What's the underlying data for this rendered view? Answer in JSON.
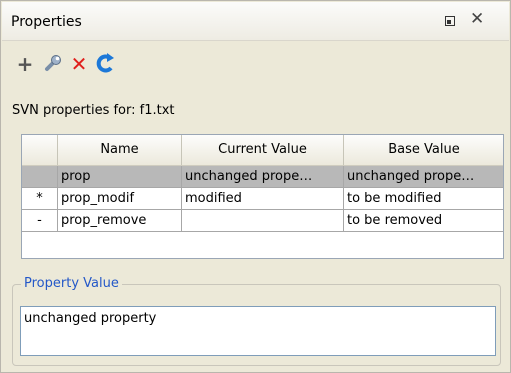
{
  "window": {
    "title": "Properties",
    "minimize_icon": "minimize-icon",
    "close_icon": "close-icon"
  },
  "toolbar": {
    "items": [
      {
        "icon": "add-icon",
        "glyph": "+"
      },
      {
        "icon": "edit-wrench-icon",
        "glyph": ""
      },
      {
        "icon": "delete-icon",
        "glyph": "✕",
        "color": "#e0201c"
      },
      {
        "icon": "refresh-icon",
        "glyph": "",
        "color": "#1c78d8"
      }
    ]
  },
  "svn_label": "SVN properties for: f1.txt",
  "table": {
    "columns": [
      "",
      "Name",
      "Current Value",
      "Base Value"
    ],
    "rows": [
      {
        "marker": "",
        "name": "prop",
        "current": "unchanged prope…",
        "base": "unchanged prope…",
        "selected": true
      },
      {
        "marker": "*",
        "name": "prop_modif",
        "current": "modified",
        "base": "to be modified",
        "selected": false
      },
      {
        "marker": "-",
        "name": "prop_remove",
        "current": "",
        "base": "to be removed",
        "selected": false
      }
    ]
  },
  "property_value": {
    "legend": "Property Value",
    "value": "unchanged property"
  },
  "colors": {
    "legend_blue": "#2458c8",
    "selection": "#b8b8b8"
  }
}
